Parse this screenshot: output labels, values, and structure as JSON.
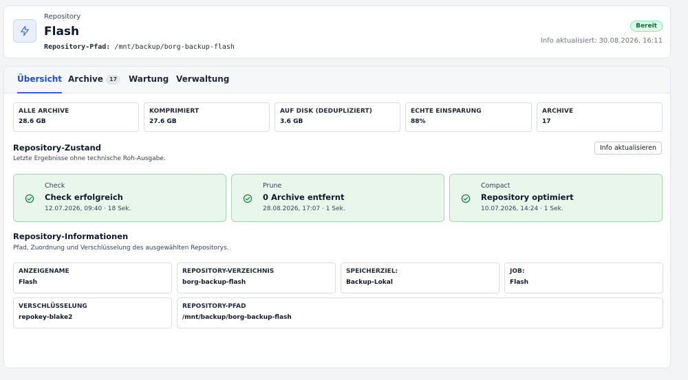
{
  "header": {
    "kicker": "Repository",
    "name": "Flash",
    "path_label": "Repository-Pfad:",
    "path_value": "/mnt/backup/borg-backup-flash",
    "status": "Bereit",
    "updated": "Info aktualisiert: 30.08.2026, 16:11",
    "icon": "bolt-icon"
  },
  "tabs": [
    {
      "label": "Übersicht",
      "active": true
    },
    {
      "label": "Archive",
      "count": "17"
    },
    {
      "label": "Wartung"
    },
    {
      "label": "Verwaltung"
    }
  ],
  "stats": [
    {
      "label": "ALLE ARCHIVE",
      "value": "28.6 GB"
    },
    {
      "label": "KOMPRIMIERT",
      "value": "27.6 GB"
    },
    {
      "label": "AUF DISK (DEDUPLIZIERT)",
      "value": "3.6 GB"
    },
    {
      "label": "ECHTE EINSPARUNG",
      "value": "88%"
    },
    {
      "label": "ARCHIVE",
      "value": "17"
    }
  ],
  "state": {
    "title": "Repository-Zustand",
    "subtitle": "Letzte Ergebnisse ohne technische Roh-Ausgabe.",
    "refresh_label": "Info aktualisieren",
    "cards": [
      {
        "kind": "Check",
        "result": "Check erfolgreich",
        "time": "12.07.2026, 09:40 · 18 Sek."
      },
      {
        "kind": "Prune",
        "result": "0 Archive entfernt",
        "time": "28.08.2026, 17:07 · 1 Sek."
      },
      {
        "kind": "Compact",
        "result": "Repository optimiert",
        "time": "10.07.2026, 14:24 · 1 Sek."
      }
    ]
  },
  "info": {
    "title": "Repository-Informationen",
    "subtitle": "Pfad, Zuordnung und Verschlüsselung des ausgewählten Repositorys.",
    "fields": [
      {
        "label": "ANZEIGENAME",
        "value": "Flash"
      },
      {
        "label": "REPOSITORY-VERZEICHNIS",
        "value": "borg-backup-flash"
      },
      {
        "label": "SPEICHERZIEL:",
        "value": "Backup-Lokal"
      },
      {
        "label": "JOB:",
        "value": "Flash"
      },
      {
        "label": "VERSCHLÜSSELUNG",
        "value": "repokey-blake2"
      },
      {
        "label": "REPOSITORY-PFAD",
        "value": "/mnt/backup/borg-backup-flash"
      }
    ]
  },
  "colors": {
    "accent": "#2563eb",
    "success_bg": "#e8f6ec",
    "success_border": "#9fd8b0",
    "success_icon": "#15803d"
  }
}
